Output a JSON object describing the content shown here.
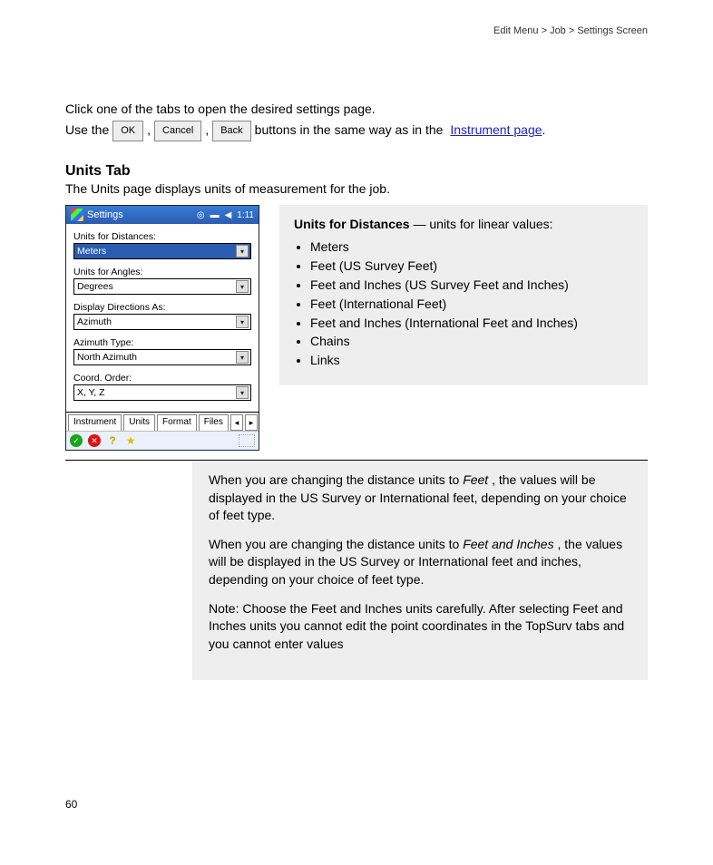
{
  "header": {
    "breadcrumb": "Edit Menu > Job > Settings Screen"
  },
  "intro": {
    "p1": "Click one of the tabs to open the desired settings page.",
    "p2a": "Use the ",
    "btn_ok": "OK",
    "btn_cancel": "Cancel",
    "btn_back": "Back",
    "p2b": " buttons in the same way as in the",
    "link": "Instrument page",
    "p2c": "."
  },
  "h2": "Units Tab",
  "subtitle": "The Units page displays units of measurement for the job.",
  "device": {
    "title": "Settings",
    "time": "1:11",
    "labels": {
      "dist": "Units for Distances:",
      "ang": "Units for Angles:",
      "dir": "Display Directions As:",
      "az": "Azimuth Type:",
      "coord": "Coord. Order:"
    },
    "values": {
      "dist": "Meters",
      "ang": "Degrees",
      "dir": "Azimuth",
      "az": "North Azimuth",
      "coord": "X, Y, Z"
    },
    "tabs": {
      "t1": "Instrument",
      "t2": "Units",
      "t3": "Format",
      "t4": "Files"
    }
  },
  "dist_block": {
    "lead_bold": "Units for Distances",
    "lead_rest": " — units for linear values:",
    "items": [
      "Meters",
      "Feet (US Survey Feet)",
      "Feet and Inches (US Survey Feet and Inches)",
      "Feet (International Feet)",
      "Feet and Inches (International Feet and Inches)",
      "Chains",
      "Links"
    ]
  },
  "wide": {
    "p1a": "When you are changing the distance units to ",
    "p1b": "Feet",
    "p1c": ", the values will be displayed in the US Survey or International feet, depending on your choice of feet type.",
    "p2a": "When you are changing the distance units to ",
    "p2b": "Feet and Inches",
    "p2c": ", the values will be displayed in the US Survey or International feet and inches, depending on your choice of feet type.",
    "p3": "Note: Choose the Feet and Inches units carefully. After selecting Feet and Inches units you cannot edit the point coordinates in the TopSurv tabs and you cannot enter values"
  },
  "footer": "60"
}
